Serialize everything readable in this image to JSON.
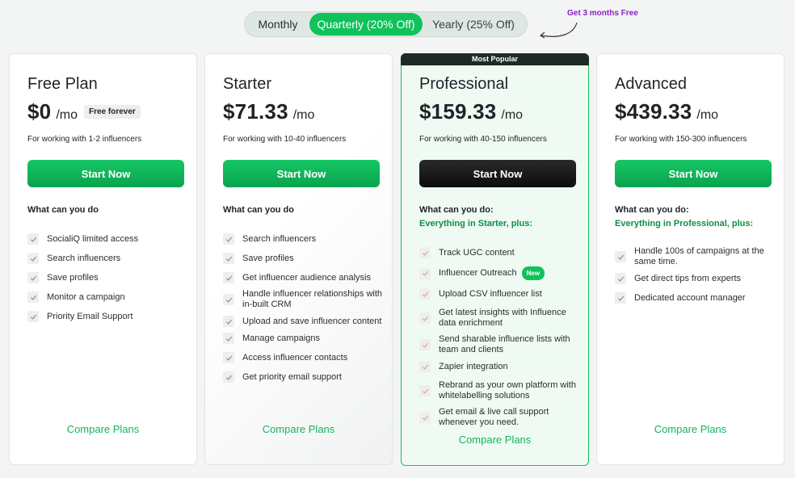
{
  "billing_toggle": {
    "monthly": "Monthly",
    "quarterly": "Quarterly (20% Off)",
    "yearly": "Yearly (25% Off)",
    "selected": "quarterly"
  },
  "promo": "Get 3 months Free",
  "plans": [
    {
      "name": "Free Plan",
      "price": "$0",
      "per": "/mo",
      "badge": "Free forever",
      "description": "For working with 1-2 influencers",
      "cta": "Start Now",
      "heading": "What can you do",
      "features": [
        "SocialiQ limited access",
        "Search influencers",
        "Save profiles",
        "Monitor a campaign",
        "Priority Email Support"
      ],
      "compare": "Compare Plans"
    },
    {
      "name": "Starter",
      "price": "$71.33",
      "per": "/mo",
      "description": "For working with 10-40 influencers",
      "cta": "Start Now",
      "heading": "What can you do",
      "features": [
        "Search influencers",
        "Save profiles",
        "Get influencer audience analysis",
        "Handle influencer relationships with in-built CRM",
        "Upload and save influencer content",
        "Manage campaigns",
        "Access influencer contacts",
        "Get priority email support"
      ],
      "compare": "Compare Plans"
    },
    {
      "banner": "Most Popular",
      "name": "Professional",
      "price": "$159.33",
      "per": "/mo",
      "description": "For working with 40-150 influencers",
      "cta": "Start Now",
      "heading": "What can you do:",
      "subheading": "Everything in Starter, plus:",
      "features": [
        "Track UGC content",
        "Influencer Outreach",
        "Upload CSV influencer list",
        "Get latest insights with Influence data enrichment",
        "Send sharable influence lists with team and clients",
        "Zapier integration",
        "Rebrand as your own platform with whitelabelling solutions",
        "Get email & live call support whenever you need."
      ],
      "new_badge": "New",
      "compare": "Compare Plans"
    },
    {
      "name": "Advanced",
      "price": "$439.33",
      "per": "/mo",
      "description": "For working with 150-300 influencers",
      "cta": "Start Now",
      "heading": "What can you do:",
      "subheading": "Everything in Professional, plus:",
      "features": [
        "Handle 100s of campaigns at the same time.",
        "Get direct tips from experts",
        "Dedicated account manager"
      ],
      "compare": "Compare Plans"
    }
  ],
  "colors": {
    "accent": "#10c25a",
    "accent_dark": "#0e8f44",
    "promo": "#8a1fc7",
    "banner": "#1e2b25"
  }
}
